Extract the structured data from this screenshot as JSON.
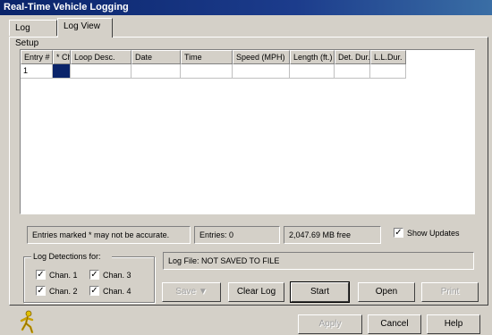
{
  "window": {
    "title": "Real-Time Vehicle Logging"
  },
  "tabs": [
    {
      "label": "Log Setup",
      "active": false
    },
    {
      "label": "Log View",
      "active": true
    }
  ],
  "table": {
    "columns": [
      "Entry #",
      "*",
      "Ch",
      "Loop Desc.",
      "Date",
      "Time",
      "Speed (MPH)",
      "Length (ft.)",
      "Det. Dur.",
      "L.L.Dur."
    ],
    "rows": [
      {
        "entry": "1",
        "marker": "",
        "ch": "",
        "loop_desc": "",
        "date": "",
        "time": "",
        "speed": "",
        "length": "",
        "det_dur": "",
        "ll_dur": ""
      }
    ]
  },
  "status": {
    "note": "Entries marked * may not be accurate.",
    "entries": "Entries: 0",
    "free": "2,047.69 MB free",
    "show_updates_label": "Show Updates",
    "show_updates_checked": true
  },
  "detections": {
    "label": "Log Detections for:",
    "channels": [
      {
        "label": "Chan. 1",
        "checked": true
      },
      {
        "label": "Chan. 2",
        "checked": true
      },
      {
        "label": "Chan. 3",
        "checked": true
      },
      {
        "label": "Chan. 4",
        "checked": true
      }
    ]
  },
  "log_file": {
    "text": "Log File:  NOT SAVED TO FILE"
  },
  "buttons": {
    "save": "Save",
    "clear": "Clear Log",
    "start": "Start",
    "open": "Open",
    "print": "Print",
    "apply": "Apply",
    "cancel": "Cancel",
    "help": "Help"
  },
  "colors": {
    "title_bar": "#0a246a",
    "face": "#d4d0c8",
    "selection": "#0a246a"
  },
  "icons": {
    "status_icon": "runner-icon",
    "save_dropdown": "dropdown-arrow-icon"
  }
}
